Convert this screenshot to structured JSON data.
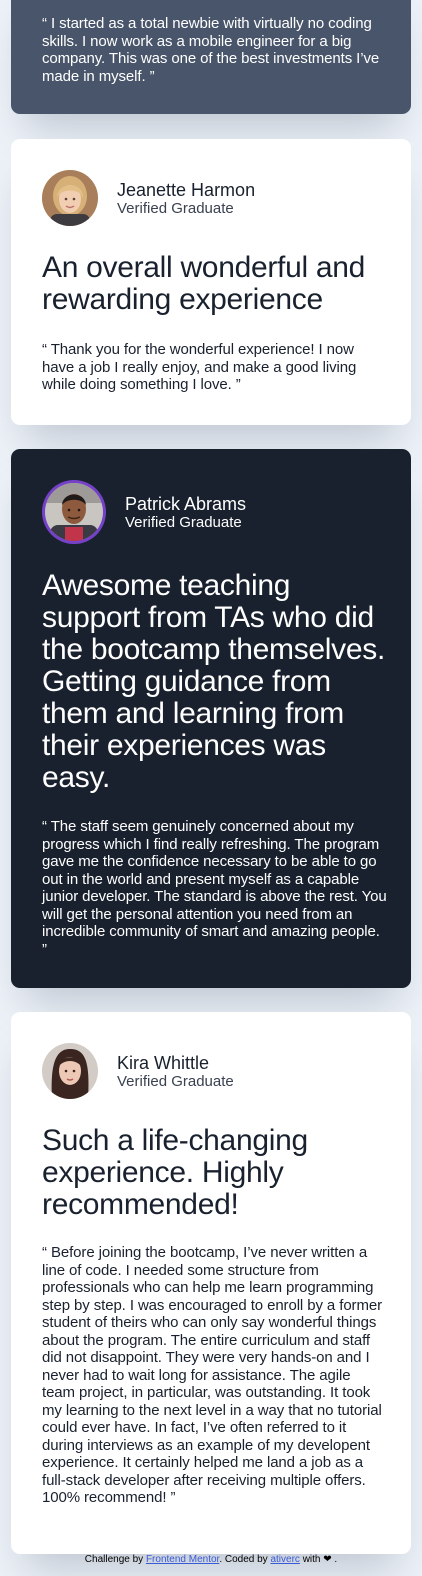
{
  "testimonials": [
    {
      "quote": "“ I started as a total newbie with virtually no coding skills. I now work as a mobile engineer for a big company. This was one of the best investments I’ve made in myself. ”"
    },
    {
      "name": "Jeanette Harmon",
      "status": "Verified Graduate",
      "title": "An overall wonderful and rewarding experience",
      "quote": "“ Thank you for the wonderful experience! I now have a job I really enjoy, and make a good living while doing something I love. ”"
    },
    {
      "name": "Patrick Abrams",
      "status": "Verified Graduate",
      "title": "Awesome teaching support from TAs who did the bootcamp themselves. Getting guidance from them and learning from their experiences was easy.",
      "quote": "“ The staff seem genuinely concerned about my progress which I find really refreshing. The program gave me the confidence necessary to be able to go out in the world and present myself as a capable junior developer. The standard is above the rest. You will get the personal attention you need from an incredible community of smart and amazing people. ”"
    },
    {
      "name": "Kira Whittle",
      "status": "Verified Graduate",
      "title": "Such a life-changing experience. Highly recommended!",
      "quote": "“ Before joining the bootcamp, I’ve never written a line of code. I needed some structure from professionals who can help me learn programming step by step. I was encouraged to enroll by a former student of theirs who can only say wonderful things about the program. The entire curriculum and staff did not disappoint. They were very hands-on and I never had to wait long for assistance. The agile team project, in particular, was outstanding. It took my learning to the next level in a way that no tutorial could ever have. In fact, I’ve often referred to it during interviews as an example of my developent experience. It certainly helped me land a job as a full-stack developer after receiving multiple offers. 100% recommend! ”"
    }
  ],
  "attribution": {
    "prefix": "Challenge by ",
    "link1": "Frontend Mentor",
    "middle": ". Coded by ",
    "link2": "ativerc",
    "suffix": " with ❤ ."
  },
  "colors": {
    "page_bg": "#edf2f8",
    "grayish_blue": "#48556a",
    "dark_blackish_blue": "#19212e",
    "white": "#ffffff",
    "avatar_ring": "#7541c8"
  },
  "icons": {
    "avatars": [
      "jeanette-avatar-icon",
      "patrick-avatar-icon",
      "kira-avatar-icon"
    ],
    "heart": "heart-icon"
  }
}
